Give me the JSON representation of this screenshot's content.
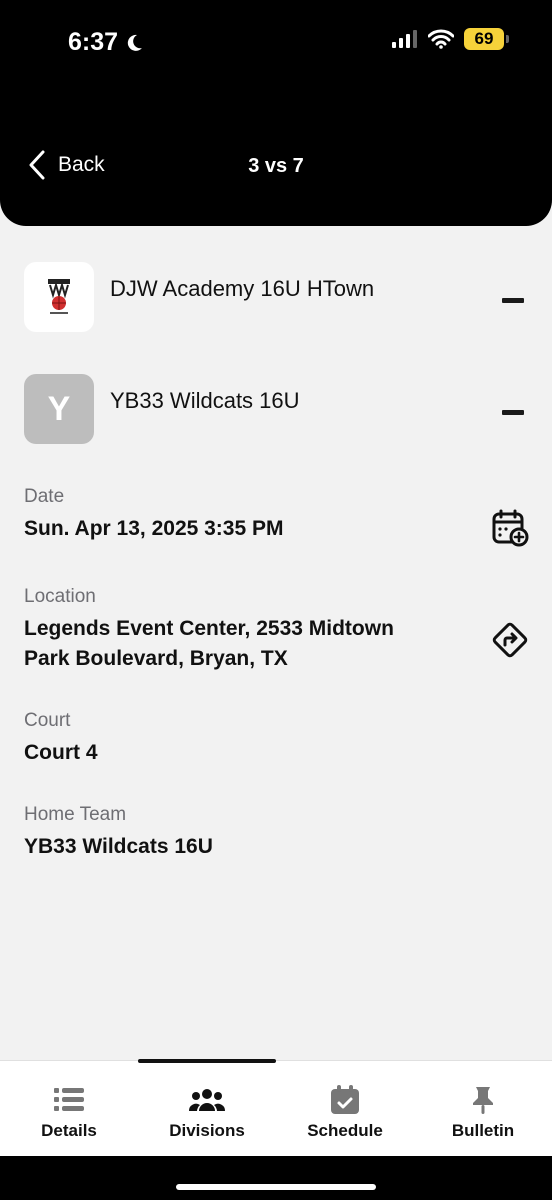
{
  "status_bar": {
    "time": "6:37",
    "battery": "69"
  },
  "nav": {
    "back_label": "Back",
    "title": "3 vs 7"
  },
  "teams": [
    {
      "name": "DJW Academy 16U HTown",
      "logo_text": ""
    },
    {
      "name": "YB33 Wildcats 16U",
      "logo_text": "Y"
    }
  ],
  "game": {
    "date_label": "Date",
    "date_value": "Sun. Apr 13, 2025 3:35 PM",
    "location_label": "Location",
    "location_line1": "Legends Event Center, 2533 Midtown",
    "location_line2": "Park Boulevard, Bryan, TX",
    "court_label": "Court",
    "court_value": "Court 4",
    "home_label": "Home Team",
    "home_value": "YB33 Wildcats 16U"
  },
  "tabs": [
    {
      "label": "Details",
      "icon": "list-icon"
    },
    {
      "label": "Divisions",
      "icon": "people-icon",
      "active": true
    },
    {
      "label": "Schedule",
      "icon": "calendar-check-icon"
    },
    {
      "label": "Bulletin",
      "icon": "pin-icon"
    }
  ],
  "colors": {
    "header_bg": "#000000",
    "battery": "#f6d23a",
    "placeholder_logo": "#bdbdbd"
  }
}
